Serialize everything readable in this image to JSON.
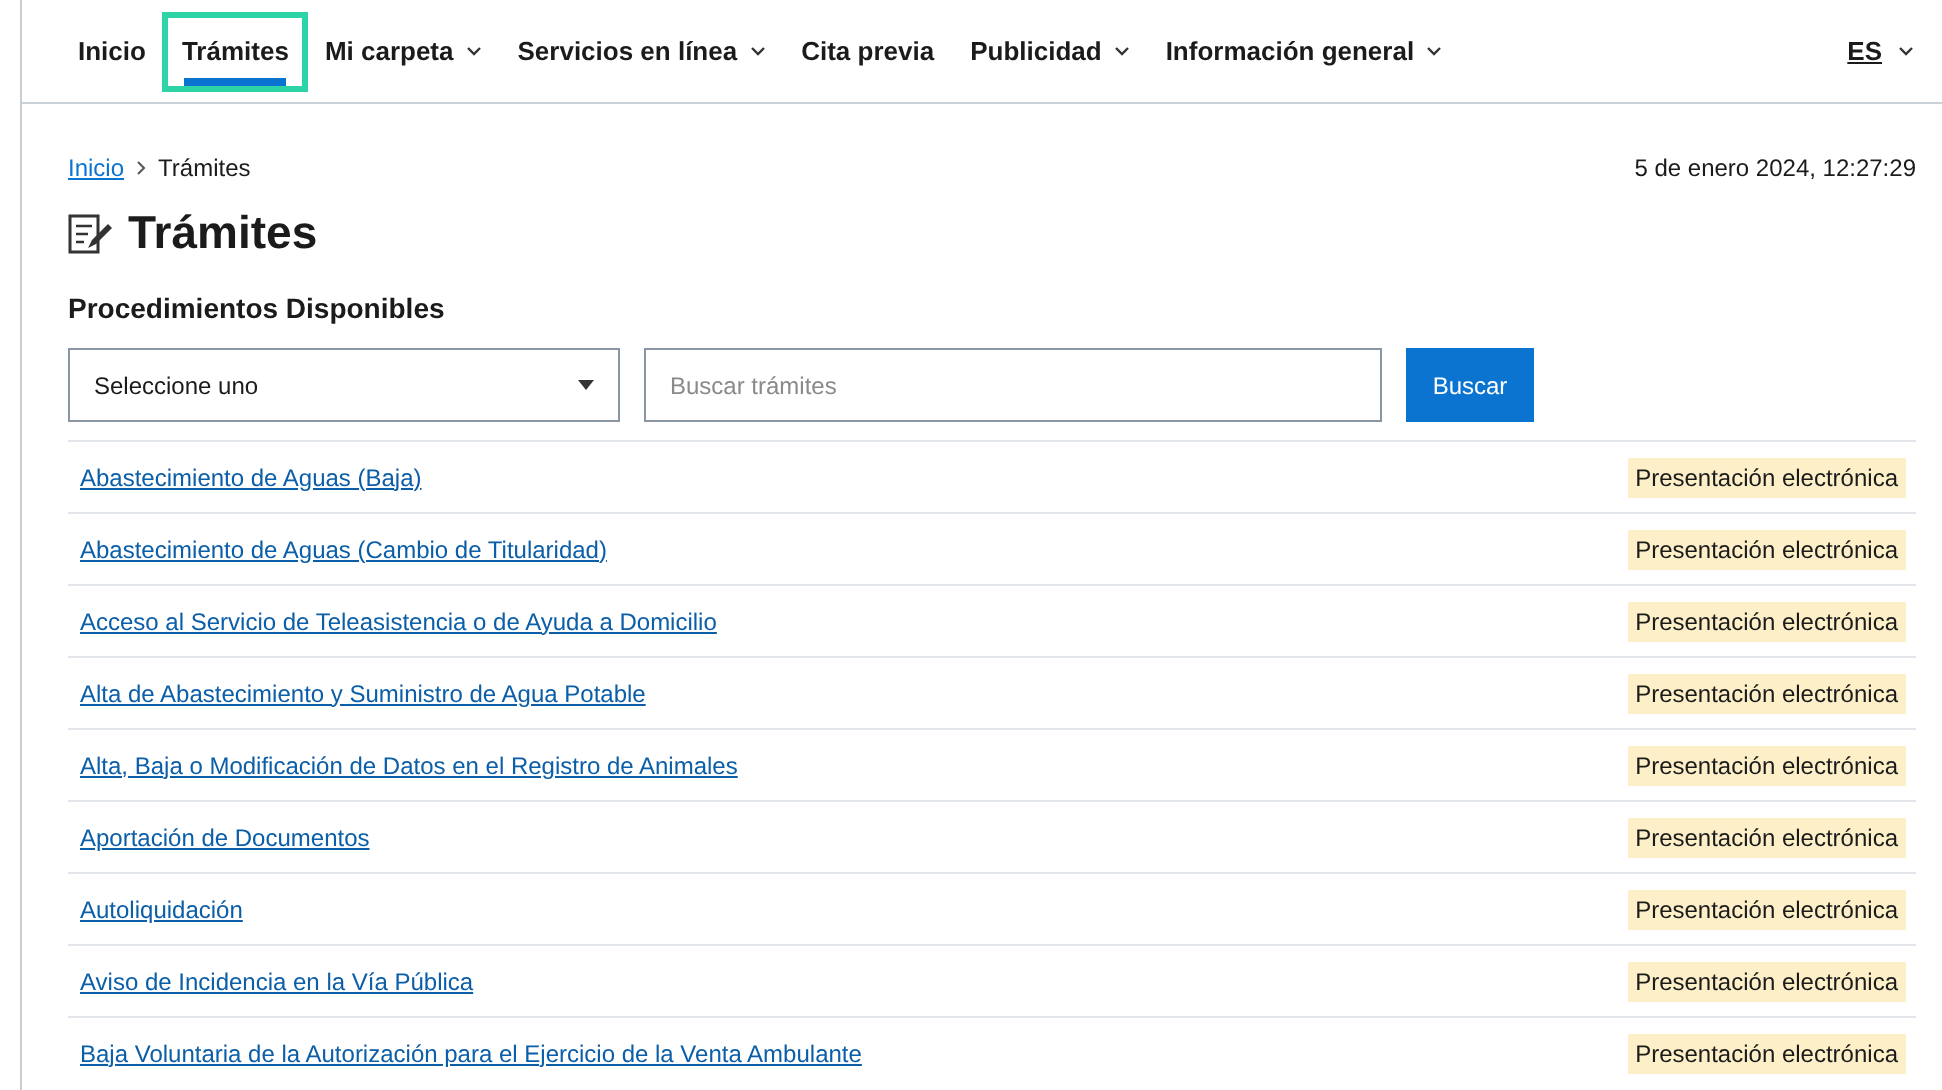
{
  "nav": {
    "items": [
      {
        "label": "Inicio",
        "selected": false,
        "has_menu": false
      },
      {
        "label": "Trámites",
        "selected": true,
        "has_menu": false
      },
      {
        "label": "Mi carpeta",
        "selected": false,
        "has_menu": true
      },
      {
        "label": "Servicios en línea",
        "selected": false,
        "has_menu": true
      },
      {
        "label": "Cita previa",
        "selected": false,
        "has_menu": false
      },
      {
        "label": "Publicidad",
        "selected": false,
        "has_menu": true
      },
      {
        "label": "Información general",
        "selected": false,
        "has_menu": true
      }
    ],
    "language": "ES"
  },
  "breadcrumb": [
    {
      "label": "Inicio",
      "kind": "link"
    },
    {
      "label": "Trámites",
      "kind": "current"
    }
  ],
  "datetime": "5 de enero 2024, 12:27:29",
  "page_title": "Trámites",
  "section_title": "Procedimientos Disponibles",
  "filter": {
    "select": "Seleccione uno",
    "search_placeholder": "Buscar trámites",
    "button": "Buscar"
  },
  "procedures": [
    {
      "name": "Abastecimiento de Aguas (Baja)",
      "tag": "Presentación electrónica"
    },
    {
      "name": "Abastecimiento de Aguas (Cambio de Titularidad)",
      "tag": "Presentación electrónica"
    },
    {
      "name": "Acceso al Servicio de Teleasistencia o de Ayuda a Domicilio",
      "tag": "Presentación electrónica"
    },
    {
      "name": "Alta de Abastecimiento y Suministro de Agua Potable",
      "tag": "Presentación electrónica"
    },
    {
      "name": "Alta, Baja o Modificación de Datos en el Registro de Animales",
      "tag": "Presentación electrónica"
    },
    {
      "name": "Aportación de Documentos",
      "tag": "Presentación electrónica"
    },
    {
      "name": "Autoliquidación",
      "tag": "Presentación electrónica"
    },
    {
      "name": "Aviso de Incidencia en la Vía Pública",
      "tag": "Presentación electrónica"
    },
    {
      "name": "Baja Voluntaria de la Autorización para el Ejercicio de la Venta Ambulante",
      "tag": "Presentación electrónica"
    }
  ]
}
